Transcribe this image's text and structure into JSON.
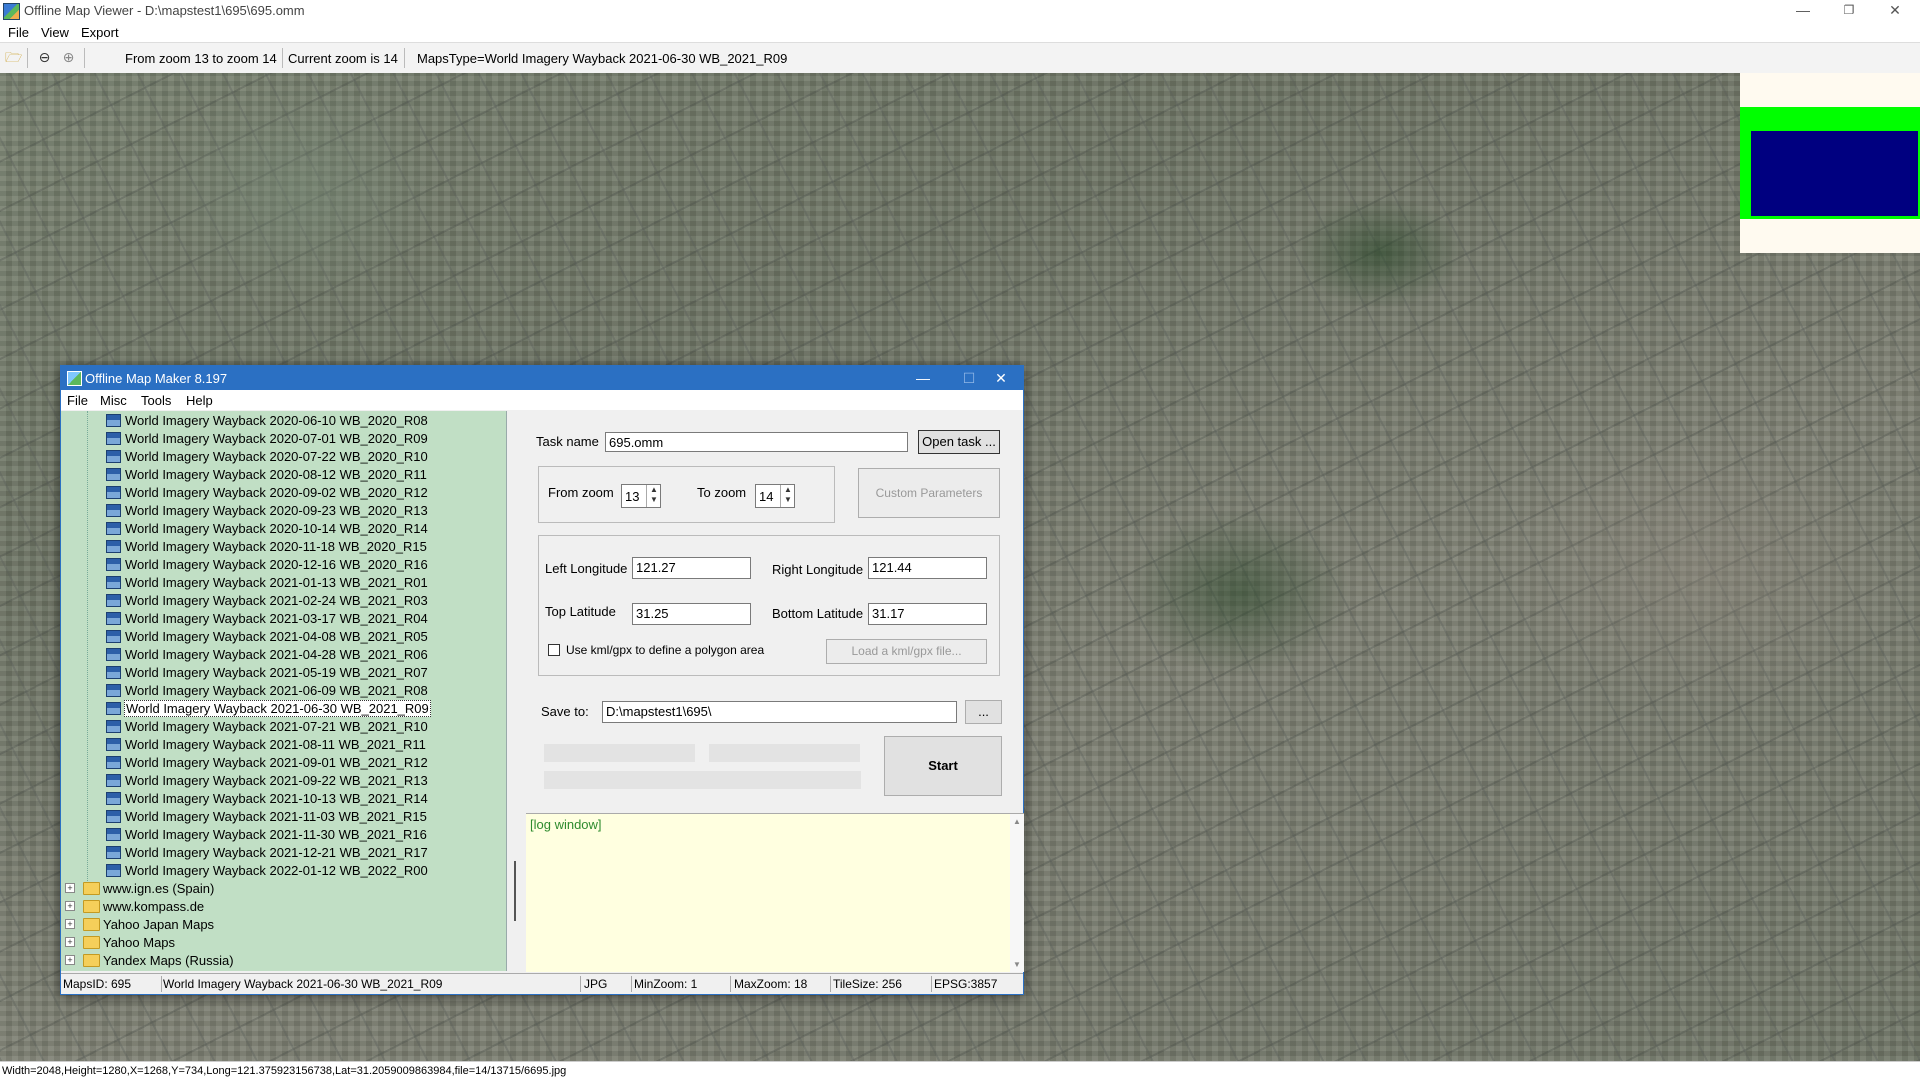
{
  "window": {
    "title": "Offline Map Viewer - D:\\mapstest1\\695\\695.omm",
    "controls": {
      "minimize": "—",
      "restore": "❐",
      "close": "✕"
    }
  },
  "menu": {
    "file": "File",
    "view": "View",
    "export": "Export"
  },
  "toolbar": {
    "zoom_range": "From zoom 13 to zoom 14",
    "current_zoom": "Current zoom is 14",
    "maps_type": "MapsType=World Imagery Wayback 2021-06-30 WB_2021_R09",
    "icons": [
      "open-folder-icon",
      "zoom-out-icon",
      "zoom-in-icon"
    ]
  },
  "status_bar": {
    "text": "Width=2048,Height=1280,X=1268,Y=734,Long=121.375923156738,Lat=31.2059009863984,file=14/13715/6695.jpg"
  },
  "minimap": {
    "frame_color": "#00ff00",
    "area_color": "#000080",
    "bg_color": "#fffaf0"
  },
  "dialog": {
    "title": "Offline Map Maker 8.197",
    "controls": {
      "minimize": "—",
      "maximize": "☐",
      "close": "✕"
    },
    "menu": {
      "file": "File",
      "misc": "Misc",
      "tools": "Tools",
      "help": "Help"
    },
    "tree": {
      "maps": [
        "World Imagery Wayback 2020-06-10 WB_2020_R08",
        "World Imagery Wayback 2020-07-01 WB_2020_R09",
        "World Imagery Wayback 2020-07-22 WB_2020_R10",
        "World Imagery Wayback 2020-08-12 WB_2020_R11",
        "World Imagery Wayback 2020-09-02 WB_2020_R12",
        "World Imagery Wayback 2020-09-23 WB_2020_R13",
        "World Imagery Wayback 2020-10-14 WB_2020_R14",
        "World Imagery Wayback 2020-11-18 WB_2020_R15",
        "World Imagery Wayback 2020-12-16 WB_2020_R16",
        "World Imagery Wayback 2021-01-13 WB_2021_R01",
        "World Imagery Wayback 2021-02-24 WB_2021_R03",
        "World Imagery Wayback 2021-03-17 WB_2021_R04",
        "World Imagery Wayback 2021-04-08 WB_2021_R05",
        "World Imagery Wayback 2021-04-28 WB_2021_R06",
        "World Imagery Wayback 2021-05-19 WB_2021_R07",
        "World Imagery Wayback 2021-06-09 WB_2021_R08",
        "World Imagery Wayback 2021-06-30 WB_2021_R09",
        "World Imagery Wayback 2021-07-21 WB_2021_R10",
        "World Imagery Wayback 2021-08-11 WB_2021_R11",
        "World Imagery Wayback 2021-09-01 WB_2021_R12",
        "World Imagery Wayback 2021-09-22 WB_2021_R13",
        "World Imagery Wayback 2021-10-13 WB_2021_R14",
        "World Imagery Wayback 2021-11-03 WB_2021_R15",
        "World Imagery Wayback 2021-11-30 WB_2021_R16",
        "World Imagery Wayback 2021-12-21 WB_2021_R17",
        "World Imagery Wayback 2022-01-12 WB_2022_R00"
      ],
      "selected": "World Imagery Wayback 2021-06-30 WB_2021_R09",
      "folders": [
        "www.ign.es (Spain)",
        "www.kompass.de",
        "Yahoo Japan Maps",
        "Yahoo Maps",
        "Yandex Maps (Russia)"
      ]
    },
    "form": {
      "task_name_label": "Task name",
      "task_name_value": "695.omm",
      "open_task_button": "Open task ...",
      "from_zoom_label": "From zoom",
      "from_zoom_value": "13",
      "to_zoom_label": "To zoom",
      "to_zoom_value": "14",
      "custom_params_button": "Custom Parameters",
      "left_lon_label": "Left Longitude",
      "left_lon_value": "121.27",
      "right_lon_label": "Right Longitude",
      "right_lon_value": "121.44",
      "top_lat_label": "Top Latitude",
      "top_lat_value": "31.25",
      "bottom_lat_label": "Bottom Latitude",
      "bottom_lat_value": "31.17",
      "kml_checkbox_label": "Use kml/gpx to define a polygon area",
      "kml_checked": false,
      "load_kml_button": "Load a kml/gpx file...",
      "save_to_label": "Save to:",
      "save_to_value": "D:\\mapstest1\\695\\",
      "browse_button": "...",
      "start_button": "Start"
    },
    "log": {
      "text": "[log window]"
    },
    "status": {
      "maps_id": "MapsID: 695",
      "map_name": "World Imagery Wayback 2021-06-30 WB_2021_R09",
      "format": "JPG",
      "min_zoom": "MinZoom: 1",
      "max_zoom": "MaxZoom: 18",
      "tile_size": "TileSize: 256",
      "epsg": "EPSG:3857"
    }
  }
}
